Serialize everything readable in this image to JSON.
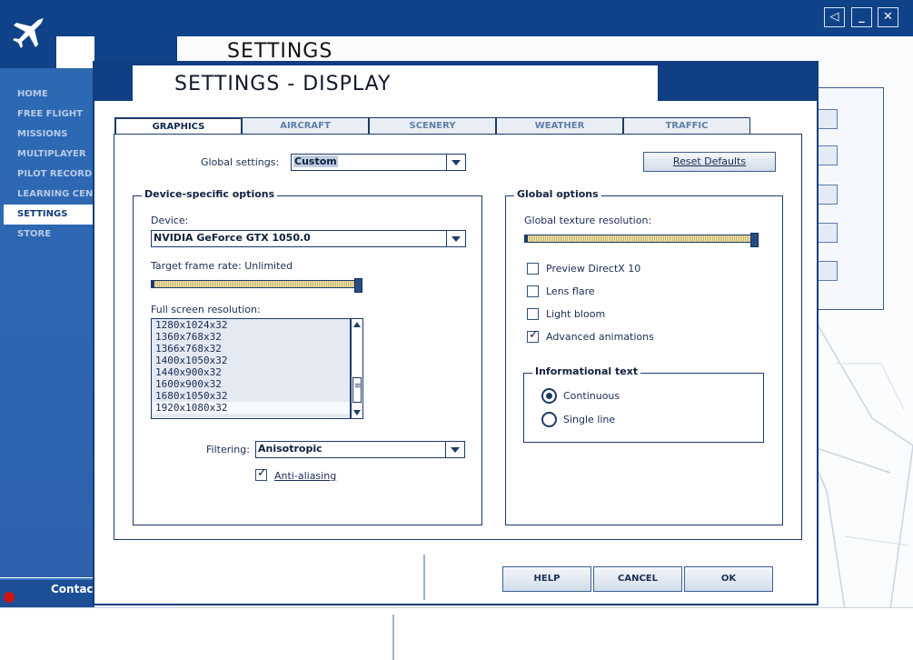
{
  "window_controls": {
    "sound_glyph": "◁",
    "minimize_glyph": "_",
    "close_glyph": "✕"
  },
  "sidebar": {
    "items": [
      {
        "label": "HOME"
      },
      {
        "label": "FREE FLIGHT"
      },
      {
        "label": "MISSIONS"
      },
      {
        "label": "MULTIPLAYER"
      },
      {
        "label": "PILOT RECORDS"
      },
      {
        "label": "LEARNING CENTER"
      },
      {
        "label": "SETTINGS",
        "active": true
      },
      {
        "label": "STORE"
      }
    ],
    "contact": "Contact"
  },
  "background": {
    "title": "SETTINGS"
  },
  "dialog": {
    "title": "SETTINGS - DISPLAY",
    "tabs": [
      {
        "label": "GRAPHICS",
        "active": true
      },
      {
        "label": "AIRCRAFT"
      },
      {
        "label": "SCENERY"
      },
      {
        "label": "WEATHER"
      },
      {
        "label": "TRAFFIC"
      }
    ],
    "global_settings": {
      "label": "Global settings:",
      "value": "Custom"
    },
    "reset_defaults": "Reset Defaults",
    "device_group": {
      "title": "Device-specific options",
      "device_label": "Device:",
      "device_value": "NVIDIA GeForce GTX 1050.0",
      "frame_rate_label": "Target frame rate: Unlimited",
      "frame_rate_level": 1.0,
      "resolution_label": "Full screen resolution:",
      "resolutions": [
        "1280x1024x32",
        "1360x768x32",
        "1366x768x32",
        "1400x1050x32",
        "1440x900x32",
        "1600x900x32",
        "1680x1050x32",
        "1920x1080x32"
      ],
      "selected_resolution": "1920x1080x32",
      "filtering_label": "Filtering:",
      "filtering_value": "Anisotropic",
      "antialiasing_label": "Anti-aliasing",
      "antialiasing_checked": true
    },
    "global_group": {
      "title": "Global options",
      "texture_label": "Global texture resolution:",
      "texture_level": 1.0,
      "checkboxes": [
        {
          "label": "Preview DirectX 10",
          "checked": false
        },
        {
          "label": "Lens flare",
          "checked": false
        },
        {
          "label": "Light bloom",
          "checked": false
        },
        {
          "label": "Advanced animations",
          "checked": true
        }
      ],
      "info_text": {
        "title": "Informational text",
        "options": [
          {
            "label": "Continuous",
            "selected": true
          },
          {
            "label": "Single line",
            "selected": false
          }
        ]
      }
    },
    "buttons": {
      "help": "HELP",
      "cancel": "CANCEL",
      "ok": "OK"
    }
  }
}
